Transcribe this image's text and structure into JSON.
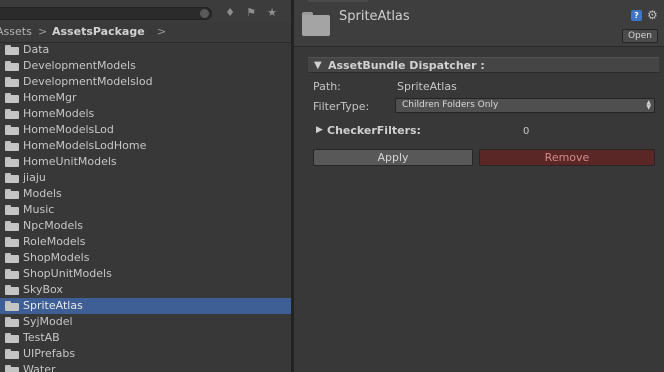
{
  "project": {
    "breadcrumb": {
      "root": "Assets",
      "separator": ">",
      "current": "AssetsPackage"
    },
    "toolbar_icons": [
      "filter-by-type-icon",
      "filter-by-label-icon",
      "favorite-star-icon"
    ],
    "folders": [
      "Data",
      "DevelopmentModels",
      "DevelopmentModelslod",
      "HomeMgr",
      "HomeModels",
      "HomeModelsLod",
      "HomeModelsLodHome",
      "HomeUnitModels",
      "jiaju",
      "Models",
      "Music",
      "NpcModels",
      "RoleModels",
      "ShopModels",
      "ShopUnitModels",
      "SkyBox",
      "SpriteAtlas",
      "SyjModel",
      "TestAB",
      "UIPrefabs",
      "Water"
    ],
    "selected_folder": "SpriteAtlas"
  },
  "inspector": {
    "asset_title": "SpriteAtlas",
    "open_label": "Open",
    "help_glyph": "?",
    "section_title": "AssetBundle Dispatcher :",
    "path_label": "Path:",
    "path_value": "SpriteAtlas",
    "filter_label": "FilterType:",
    "filter_value": "Children Folders Only",
    "checker_label": "CheckerFilters:",
    "checker_count": "0",
    "apply_label": "Apply",
    "remove_label": "Remove"
  },
  "colors": {
    "selection": "#3e5f96",
    "remove_button": "#5b2626",
    "help_icon": "#3f74c9"
  }
}
